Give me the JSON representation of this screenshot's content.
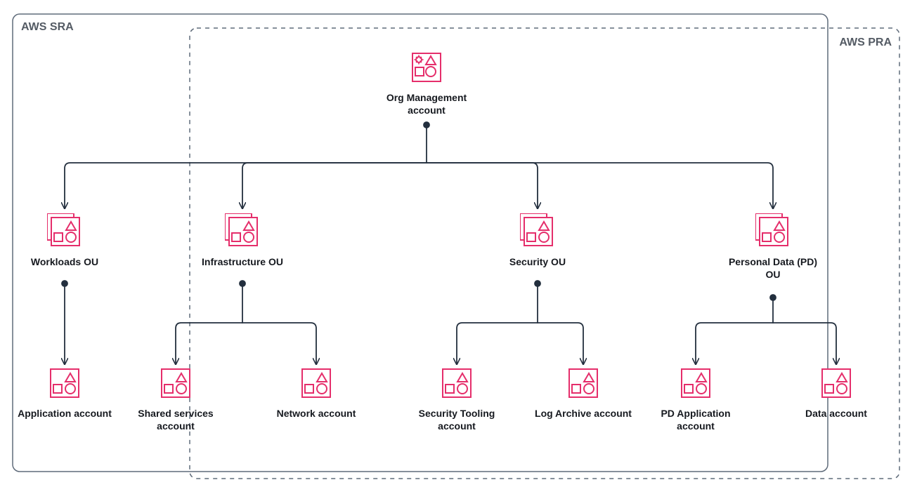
{
  "frames": {
    "sra": "AWS SRA",
    "pra": "AWS PRA"
  },
  "nodes": {
    "root": {
      "label": "Org Management account"
    },
    "workloads_ou": {
      "label": "Workloads OU"
    },
    "infra_ou": {
      "label": "Infrastructure OU"
    },
    "security_ou": {
      "label": "Security OU"
    },
    "pd_ou": {
      "label": "Personal Data (PD) OU"
    },
    "application": {
      "label": "Application account"
    },
    "shared_services": {
      "label": "Shared services account"
    },
    "network": {
      "label": "Network account"
    },
    "sec_tooling": {
      "label": "Security Tooling account"
    },
    "log_archive": {
      "label": "Log Archive account"
    },
    "pd_application": {
      "label": "PD Application account"
    },
    "data": {
      "label": "Data account"
    }
  },
  "colors": {
    "brand": "#e52e6b",
    "line": "#232f3e",
    "frame": "#5f6b7a"
  }
}
